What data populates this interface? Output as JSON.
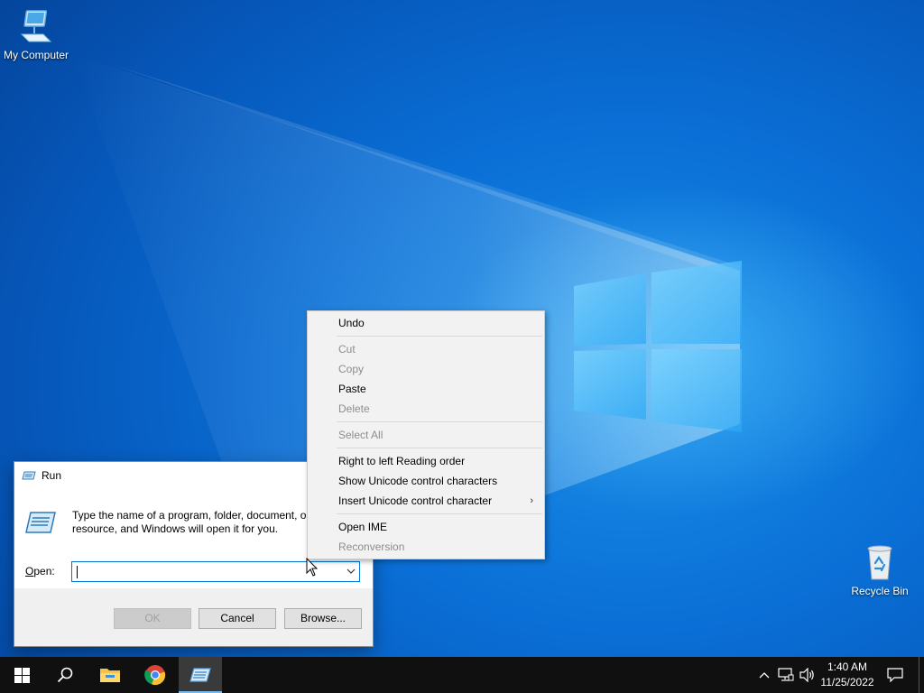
{
  "desktop": {
    "icons": [
      {
        "label": "My Computer",
        "icon": "computer-icon"
      },
      {
        "label": "Recycle Bin",
        "icon": "recycle-bin-icon"
      }
    ]
  },
  "run_dialog": {
    "title": "Run",
    "description_line1": "Type the name of a program, folder, document, or Internet",
    "description_line2": "resource, and Windows will open it for you.",
    "open_label": "Open:",
    "open_value": "",
    "ok_label": "OK",
    "cancel_label": "Cancel",
    "browse_label": "Browse..."
  },
  "context_menu": {
    "items": [
      {
        "label": "Undo",
        "enabled": true
      },
      {
        "label": "Cut",
        "enabled": false
      },
      {
        "label": "Copy",
        "enabled": false
      },
      {
        "label": "Paste",
        "enabled": true
      },
      {
        "label": "Delete",
        "enabled": false
      },
      {
        "label": "Select All",
        "enabled": false
      },
      {
        "label": "Right to left Reading order",
        "enabled": true
      },
      {
        "label": "Show Unicode control characters",
        "enabled": true
      },
      {
        "label": "Insert Unicode control character",
        "enabled": true,
        "submenu": true
      },
      {
        "label": "Open IME",
        "enabled": true
      },
      {
        "label": "Reconversion",
        "enabled": false
      }
    ]
  },
  "taskbar": {
    "apps": [
      "start-icon",
      "search-icon",
      "file-explorer-icon",
      "chrome-icon",
      "run-icon"
    ],
    "clock": {
      "time": "1:40 AM",
      "date": "11/25/2022"
    }
  },
  "colors": {
    "accent": "#0078d7",
    "taskbar": "#101010",
    "menu_bg": "#f2f2f2"
  }
}
